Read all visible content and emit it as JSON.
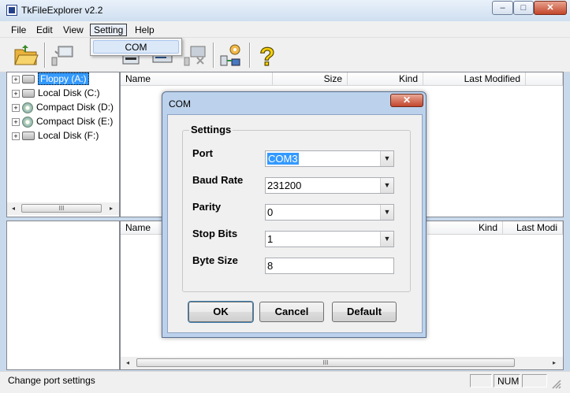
{
  "window": {
    "title": "TkFileExplorer v2.2",
    "minimize": "–",
    "maximize": "□",
    "close": "✕"
  },
  "menubar": {
    "items": [
      "File",
      "Edit",
      "View",
      "Setting",
      "Help"
    ]
  },
  "setting_menu": {
    "items": [
      "COM"
    ]
  },
  "tree": {
    "items": [
      {
        "label": "Floppy (A:)",
        "icon": "floppy-drive-icon"
      },
      {
        "label": "Local Disk (C:)",
        "icon": "hard-drive-icon"
      },
      {
        "label": "Compact Disk (D:)",
        "icon": "cd-drive-icon"
      },
      {
        "label": "Compact Disk (E:)",
        "icon": "cd-drive-icon"
      },
      {
        "label": "Local Disk (F:)",
        "icon": "hard-drive-icon"
      }
    ]
  },
  "top_list": {
    "columns": [
      "Name",
      "Size",
      "Kind",
      "Last Modified"
    ]
  },
  "bottom_list": {
    "columns": [
      "Name",
      "Kind",
      "Last Modi"
    ]
  },
  "scrollbar": {
    "grip": "III",
    "left": "◂",
    "right": "▸"
  },
  "dialog": {
    "title": "COM",
    "close": "✕",
    "group_label": "Settings",
    "fields": {
      "port": {
        "label": "Port",
        "value": "COM3"
      },
      "baud": {
        "label": "Baud Rate",
        "value": "231200"
      },
      "parity": {
        "label": "Parity",
        "value": "0"
      },
      "stopbits": {
        "label": "Stop Bits",
        "value": "1"
      },
      "bytesize": {
        "label": "Byte Size",
        "value": "8"
      }
    },
    "buttons": {
      "ok": "OK",
      "cancel": "Cancel",
      "default": "Default"
    },
    "dropdown_arrow": "▼"
  },
  "status": {
    "text": "Change port settings",
    "num": "NUM"
  },
  "colors": {
    "selection": "#3399ff",
    "close_button": "#c3462b",
    "dialog_frame": "#bcd2ec"
  }
}
